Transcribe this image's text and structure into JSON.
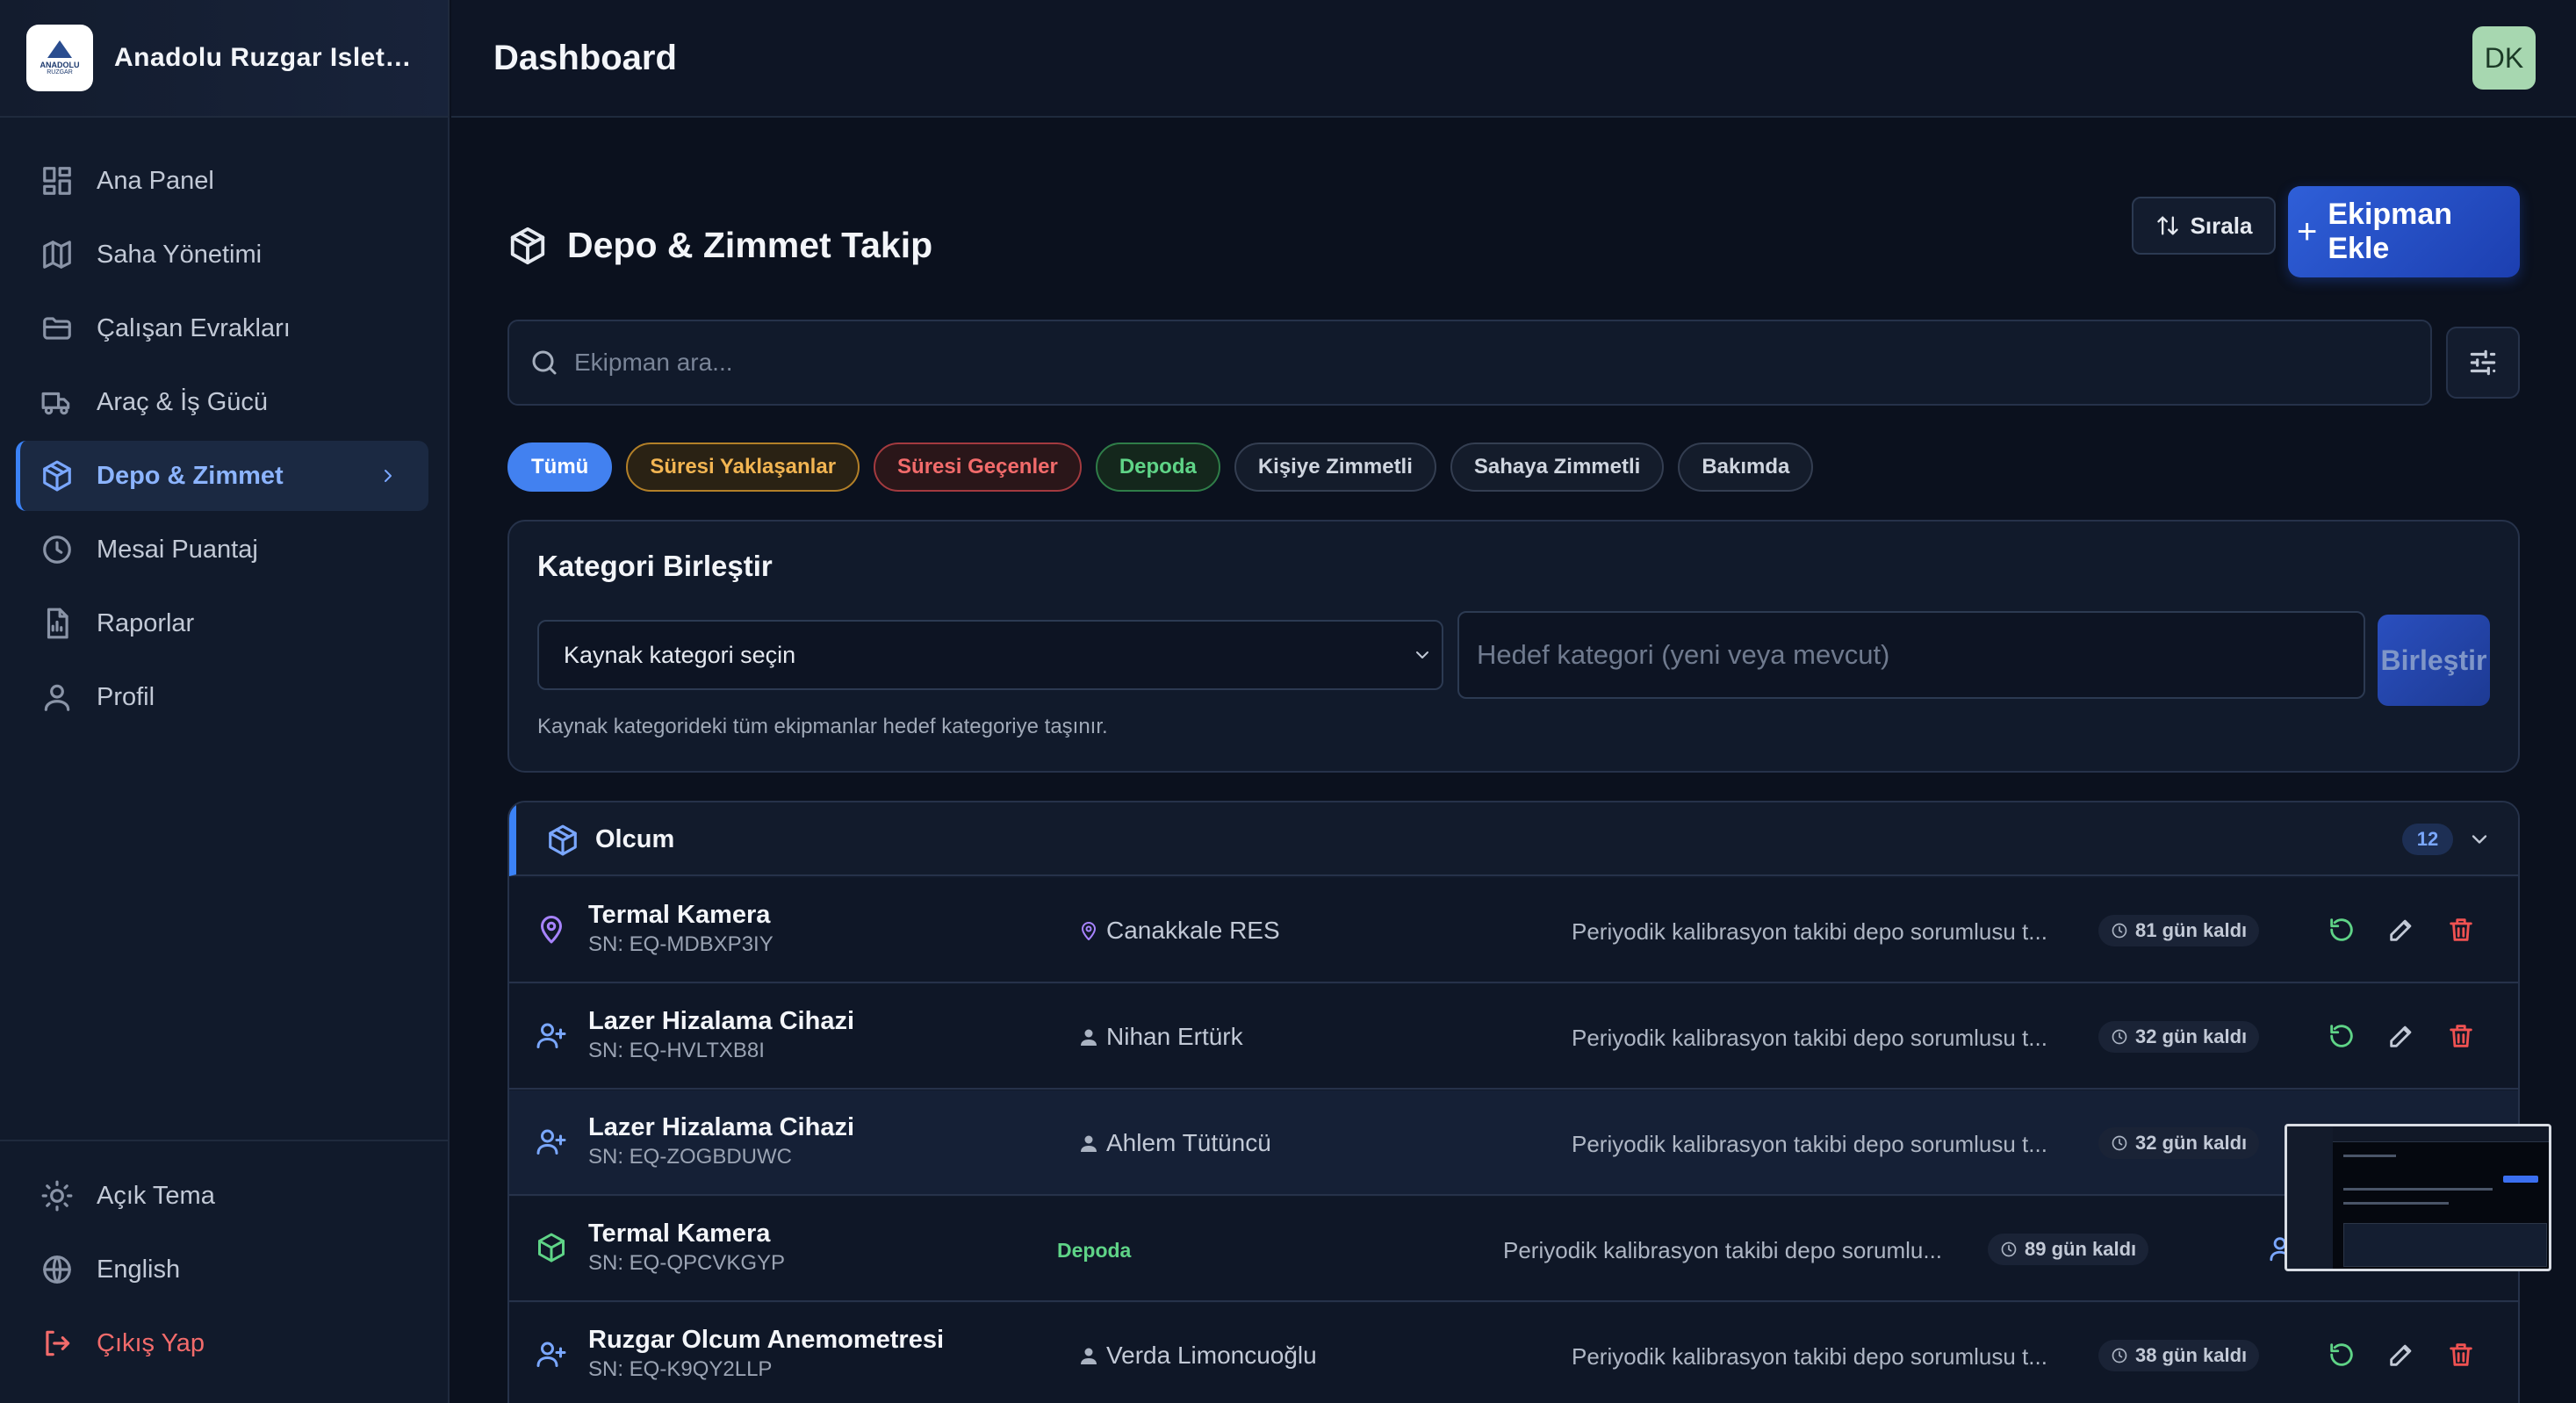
{
  "brand": {
    "name": "Anadolu Ruzgar Isletmeleri",
    "logo_line1": "ANADOLU",
    "logo_line2": "RUZGAR"
  },
  "nav": {
    "items": [
      {
        "label": "Ana Panel",
        "icon": "grid-icon"
      },
      {
        "label": "Saha Yönetimi",
        "icon": "map-icon"
      },
      {
        "label": "Çalışan Evrakları",
        "icon": "folder-icon"
      },
      {
        "label": "Araç & İş Gücü",
        "icon": "truck-icon"
      },
      {
        "label": "Depo & Zimmet",
        "icon": "package-icon",
        "active": true
      },
      {
        "label": "Mesai Puantaj",
        "icon": "clock-icon"
      },
      {
        "label": "Raporlar",
        "icon": "report-icon"
      },
      {
        "label": "Profil",
        "icon": "user-icon"
      }
    ],
    "bottom": [
      {
        "label": "Açık Tema",
        "icon": "sun-icon"
      },
      {
        "label": "English",
        "icon": "globe-icon"
      },
      {
        "label": "Çıkış Yap",
        "icon": "logout-icon"
      }
    ]
  },
  "header": {
    "title": "Dashboard",
    "avatar_initials": "DK"
  },
  "section": {
    "title": "Depo & Zimmet Takip",
    "sort_label": "Sırala",
    "add_label": "Ekipman Ekle"
  },
  "search": {
    "placeholder": "Ekipman ara..."
  },
  "filters": [
    "Tümü",
    "Süresi Yaklaşanlar",
    "Süresi Geçenler",
    "Depoda",
    "Kişiye Zimmetli",
    "Sahaya Zimmetli",
    "Bakımda"
  ],
  "merge": {
    "title": "Kategori Birleştir",
    "source_value": "Kaynak kategori seçin",
    "target_placeholder": "Hedef kategori (yeni veya mevcut)",
    "button": "Birleştir",
    "hint": "Kaynak kategorideki tüm ekipmanlar hedef kategoriye taşınır."
  },
  "category": {
    "name": "Olcum",
    "count": "12",
    "rows": [
      {
        "name": "Termal Kamera",
        "sn": "SN: EQ-MDBXP3IY",
        "location": "Canakkale RES",
        "desc": "Periyodik kalibrasyon takibi depo sorumlusu t...",
        "days": "81 gün kaldı"
      },
      {
        "name": "Lazer Hizalama Cihazi",
        "sn": "SN: EQ-HVLTXB8I",
        "location": "Nihan Ertürk",
        "desc": "Periyodik kalibrasyon takibi depo sorumlusu t...",
        "days": "32 gün kaldı"
      },
      {
        "name": "Lazer Hizalama Cihazi",
        "sn": "SN: EQ-ZOGBDUWC",
        "location": "Ahlem Tütüncü",
        "desc": "Periyodik kalibrasyon takibi depo sorumlusu t...",
        "days": "32 gün kaldı"
      },
      {
        "name": "Termal Kamera",
        "sn": "SN: EQ-QPCVKGYP",
        "location": "Depoda",
        "desc": "Periyodik kalibrasyon takibi depo sorumlu...",
        "days": "89 gün kaldı"
      },
      {
        "name": "Ruzgar Olcum Anemometresi",
        "sn": "SN: EQ-K9QY2LLP",
        "location": "Verda Limoncuoğlu",
        "desc": "Periyodik kalibrasyon takibi depo sorumlusu t...",
        "days": "38 gün kaldı"
      }
    ]
  },
  "colors": {
    "accent": "#3b82f6",
    "primary_button": "#2f5fd8",
    "success": "#5fd487",
    "danger": "#f05252",
    "warning": "#f2b552"
  }
}
